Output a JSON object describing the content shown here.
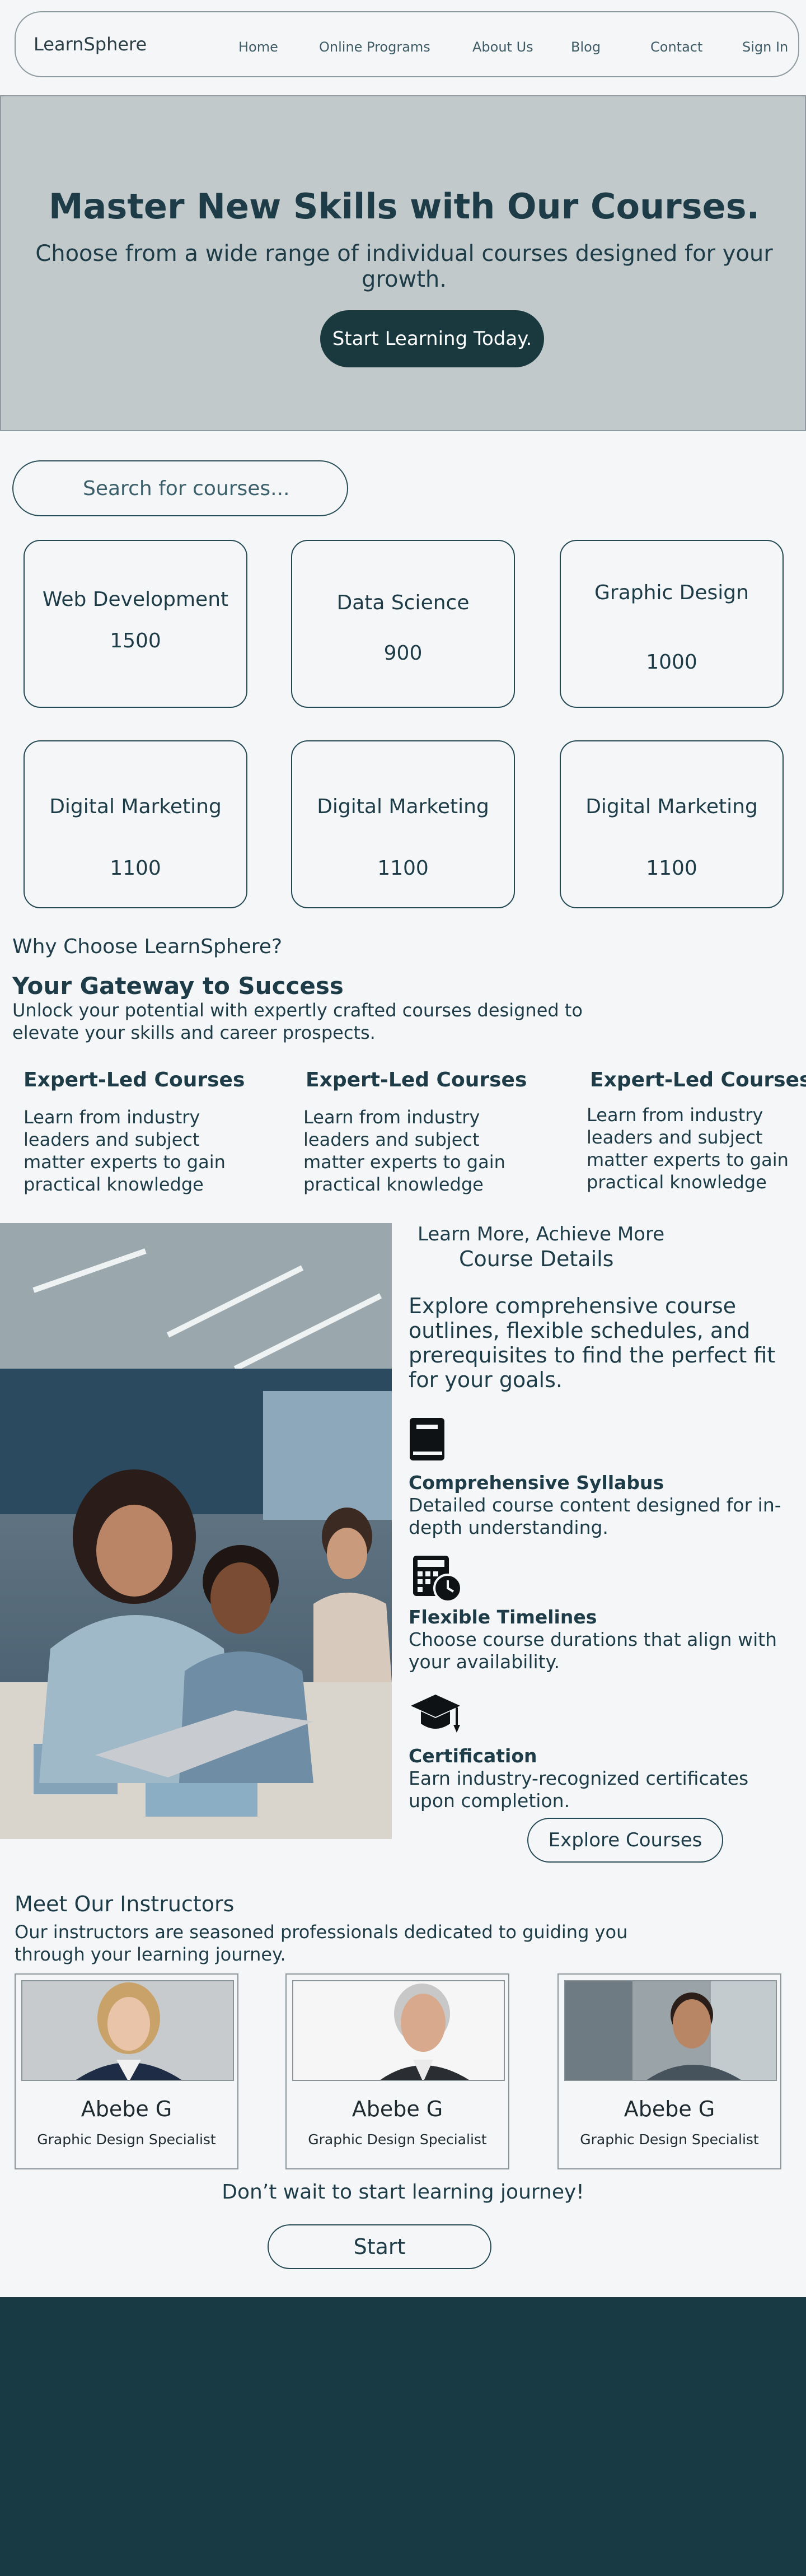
{
  "nav": {
    "logo": "LearnSphere",
    "links": [
      "Home",
      "Online Programs",
      "About Us",
      "Blog",
      "Contact",
      "Sign In"
    ]
  },
  "hero": {
    "title": "Master New Skills with Our Courses.",
    "subtitle": "Choose from a wide range of individual courses designed for your growth.",
    "button": "Start Learning Today."
  },
  "search": {
    "placeholder": "Search for courses..."
  },
  "courses": [
    {
      "name": "Web Development",
      "count": "1500"
    },
    {
      "name": "Data Science",
      "count": "900"
    },
    {
      "name": "Graphic Design",
      "count": "1000"
    },
    {
      "name": "Digital Marketing",
      "count": "1100"
    },
    {
      "name": "Digital Marketing",
      "count": "1100"
    },
    {
      "name": "Digital Marketing",
      "count": "1100"
    }
  ],
  "why": {
    "question": "Why Choose LearnSphere?",
    "heading": "Your Gateway to Success",
    "text": "Unlock your potential with expertly crafted courses designed to elevate your skills and career prospects.",
    "features": [
      {
        "title": "Expert-Led Courses",
        "text": "Learn from industry leaders and subject matter experts to gain practical knowledge"
      },
      {
        "title": "Expert-Led Courses",
        "text": "Learn from industry leaders and subject matter experts to gain practical knowledge"
      },
      {
        "title": "Expert-Led Courses",
        "text": "Learn from industry leaders and subject matter experts to gain practical knowledge"
      }
    ]
  },
  "details": {
    "eyebrow": "Learn More, Achieve More",
    "title": "Course Details",
    "lead": "Explore comprehensive course outlines, flexible schedules, and prerequisites to find the perfect fit for your goals.",
    "items": [
      {
        "icon": "book-icon",
        "title": "Comprehensive Syllabus",
        "text": "Detailed course content designed for in-depth understanding."
      },
      {
        "icon": "calculator-clock-icon",
        "title": "Flexible Timelines",
        "text": "Choose course durations that align with your availability."
      },
      {
        "icon": "graduation-cap-icon",
        "title": "Certification",
        "text": "Earn industry-recognized certificates upon completion."
      }
    ],
    "button": "Explore Courses"
  },
  "instructors": {
    "heading": "Meet Our Instructors",
    "text": "Our instructors are seasoned professionals dedicated to guiding you through your learning journey.",
    "people": [
      {
        "name": "Abebe G",
        "role": "Graphic Design Specialist"
      },
      {
        "name": "Abebe G",
        "role": "Graphic Design Specialist"
      },
      {
        "name": "Abebe G",
        "role": "Graphic Design Specialist"
      }
    ],
    "cta_text": "Don’t wait to start learning journey!",
    "cta_button": "Start"
  },
  "colors": {
    "footer": "#173a44",
    "hero_bg": "#c1c9cb",
    "primary_button": "#19393f",
    "text": "#1e3c47"
  }
}
